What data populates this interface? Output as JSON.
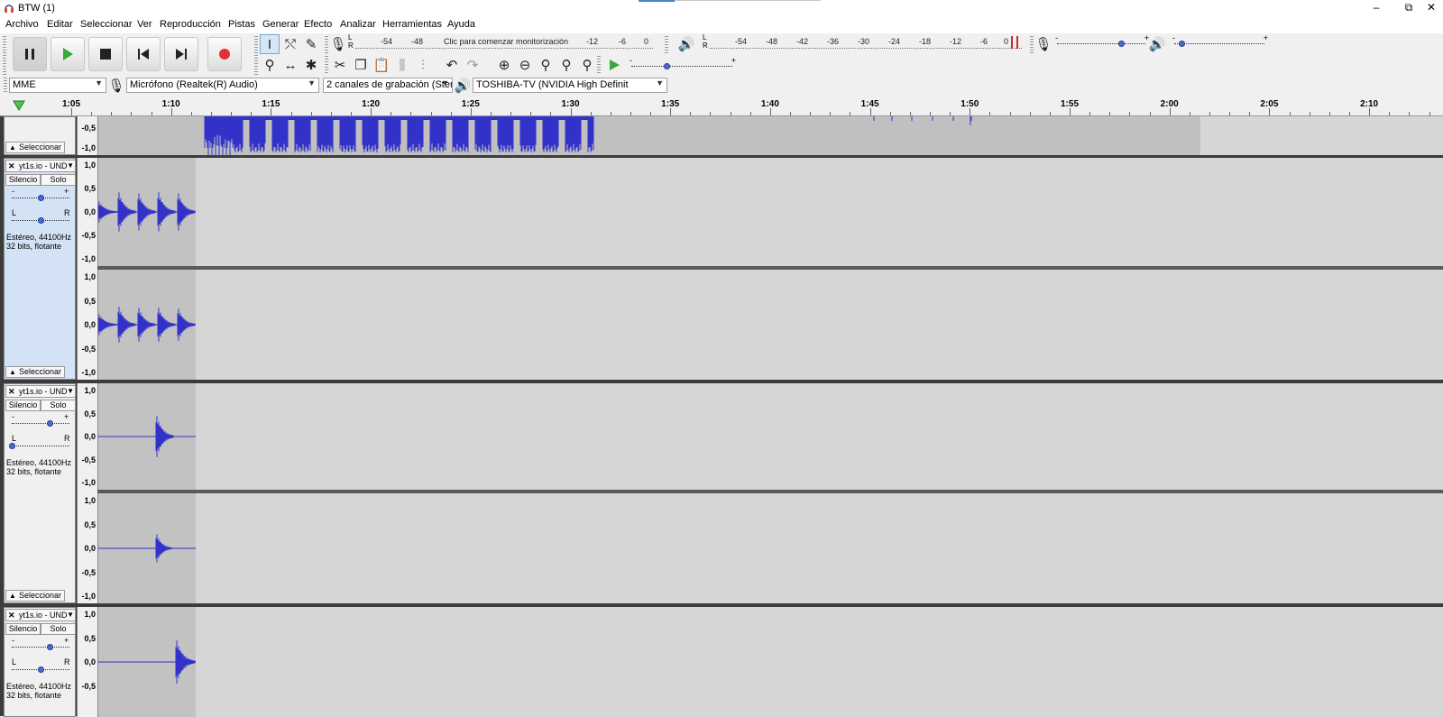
{
  "window": {
    "title": "BTW (1)",
    "minimize": "–",
    "restore": "⧉",
    "close": "✕"
  },
  "menu": [
    "Archivo",
    "Editar",
    "Seleccionar",
    "Ver",
    "Reproducción",
    "Pistas",
    "Generar",
    "Efecto",
    "Analizar",
    "Herramientas",
    "Ayuda"
  ],
  "transport": {
    "pause": "pause-icon",
    "play": "play-icon",
    "stop": "stop-icon",
    "skip_start": "skip-start-icon",
    "skip_end": "skip-end-icon",
    "record": "record-icon"
  },
  "recording_meter": {
    "L": "L",
    "R": "R",
    "ticks": [
      "-54",
      "-48",
      "-12",
      "-6",
      "0"
    ],
    "prompt": "Clic para comenzar monitorización"
  },
  "playback_meter": {
    "L": "L",
    "R": "R",
    "ticks": [
      "-54",
      "-48",
      "-42",
      "-36",
      "-30",
      "-24",
      "-18",
      "-12",
      "-6",
      "0"
    ]
  },
  "mixer": {
    "rec_minus": "-",
    "rec_plus": "+",
    "play_minus": "-",
    "play_plus": "+",
    "rec_level": 0.72,
    "play_level": 0.08
  },
  "play_at_speed": {
    "minus": "-",
    "plus": "+",
    "level": 0.35
  },
  "device": {
    "host": "MME",
    "mic": "Micrófono (Realtek(R) Audio)",
    "channels": "2 canales de grabación (Ster",
    "output": "TOSHIBA-TV (NVIDIA High Definit"
  },
  "timeline": {
    "labels": [
      "1:05",
      "1:10",
      "1:15",
      "1:20",
      "1:25",
      "1:30",
      "1:35",
      "1:40",
      "1:45",
      "1:50",
      "1:55",
      "2:00",
      "2:05",
      "2:10"
    ]
  },
  "tracks": [
    {
      "partial": true,
      "scale": [
        "-0,5",
        "-1,0"
      ],
      "select_label": "Seleccionar"
    },
    {
      "name": "yt1s.io - UND",
      "mute": "Silencio",
      "solo": "Solo",
      "gain_minus": "-",
      "gain_plus": "+",
      "pan_L": "L",
      "pan_R": "R",
      "gain": 0.5,
      "pan": 0.5,
      "info1": "Estéreo, 44100Hz",
      "info2": "32 bits, flotante",
      "select_label": "Seleccionar",
      "scale": [
        "1,0",
        "0,5",
        "0,0",
        "-0,5",
        "-1,0"
      ]
    },
    {
      "name": "yt1s.io - UND",
      "mute": "Silencio",
      "solo": "Solo",
      "gain_minus": "-",
      "gain_plus": "+",
      "pan_L": "L",
      "pan_R": "R",
      "gain": 0.65,
      "pan": 0.0,
      "info1": "Estéreo, 44100Hz",
      "info2": "32 bits, flotante",
      "select_label": "Seleccionar",
      "scale": [
        "1,0",
        "0,5",
        "0,0",
        "-0,5",
        "-1,0"
      ]
    },
    {
      "name": "yt1s.io - UND",
      "mute": "Silencio",
      "solo": "Solo",
      "gain_minus": "-",
      "gain_plus": "+",
      "pan_L": "L",
      "pan_R": "R",
      "gain": 0.65,
      "pan": 0.5,
      "info1": "Estéreo, 44100Hz",
      "info2": "32 bits, flotante",
      "scale": [
        "1,0",
        "0,5",
        "0,0",
        "-0,5"
      ]
    }
  ],
  "colors": {
    "waveform": "#3232c8",
    "selected_panel": "#d4e2f5",
    "record": "#e0303a",
    "play": "#3aa83a"
  }
}
